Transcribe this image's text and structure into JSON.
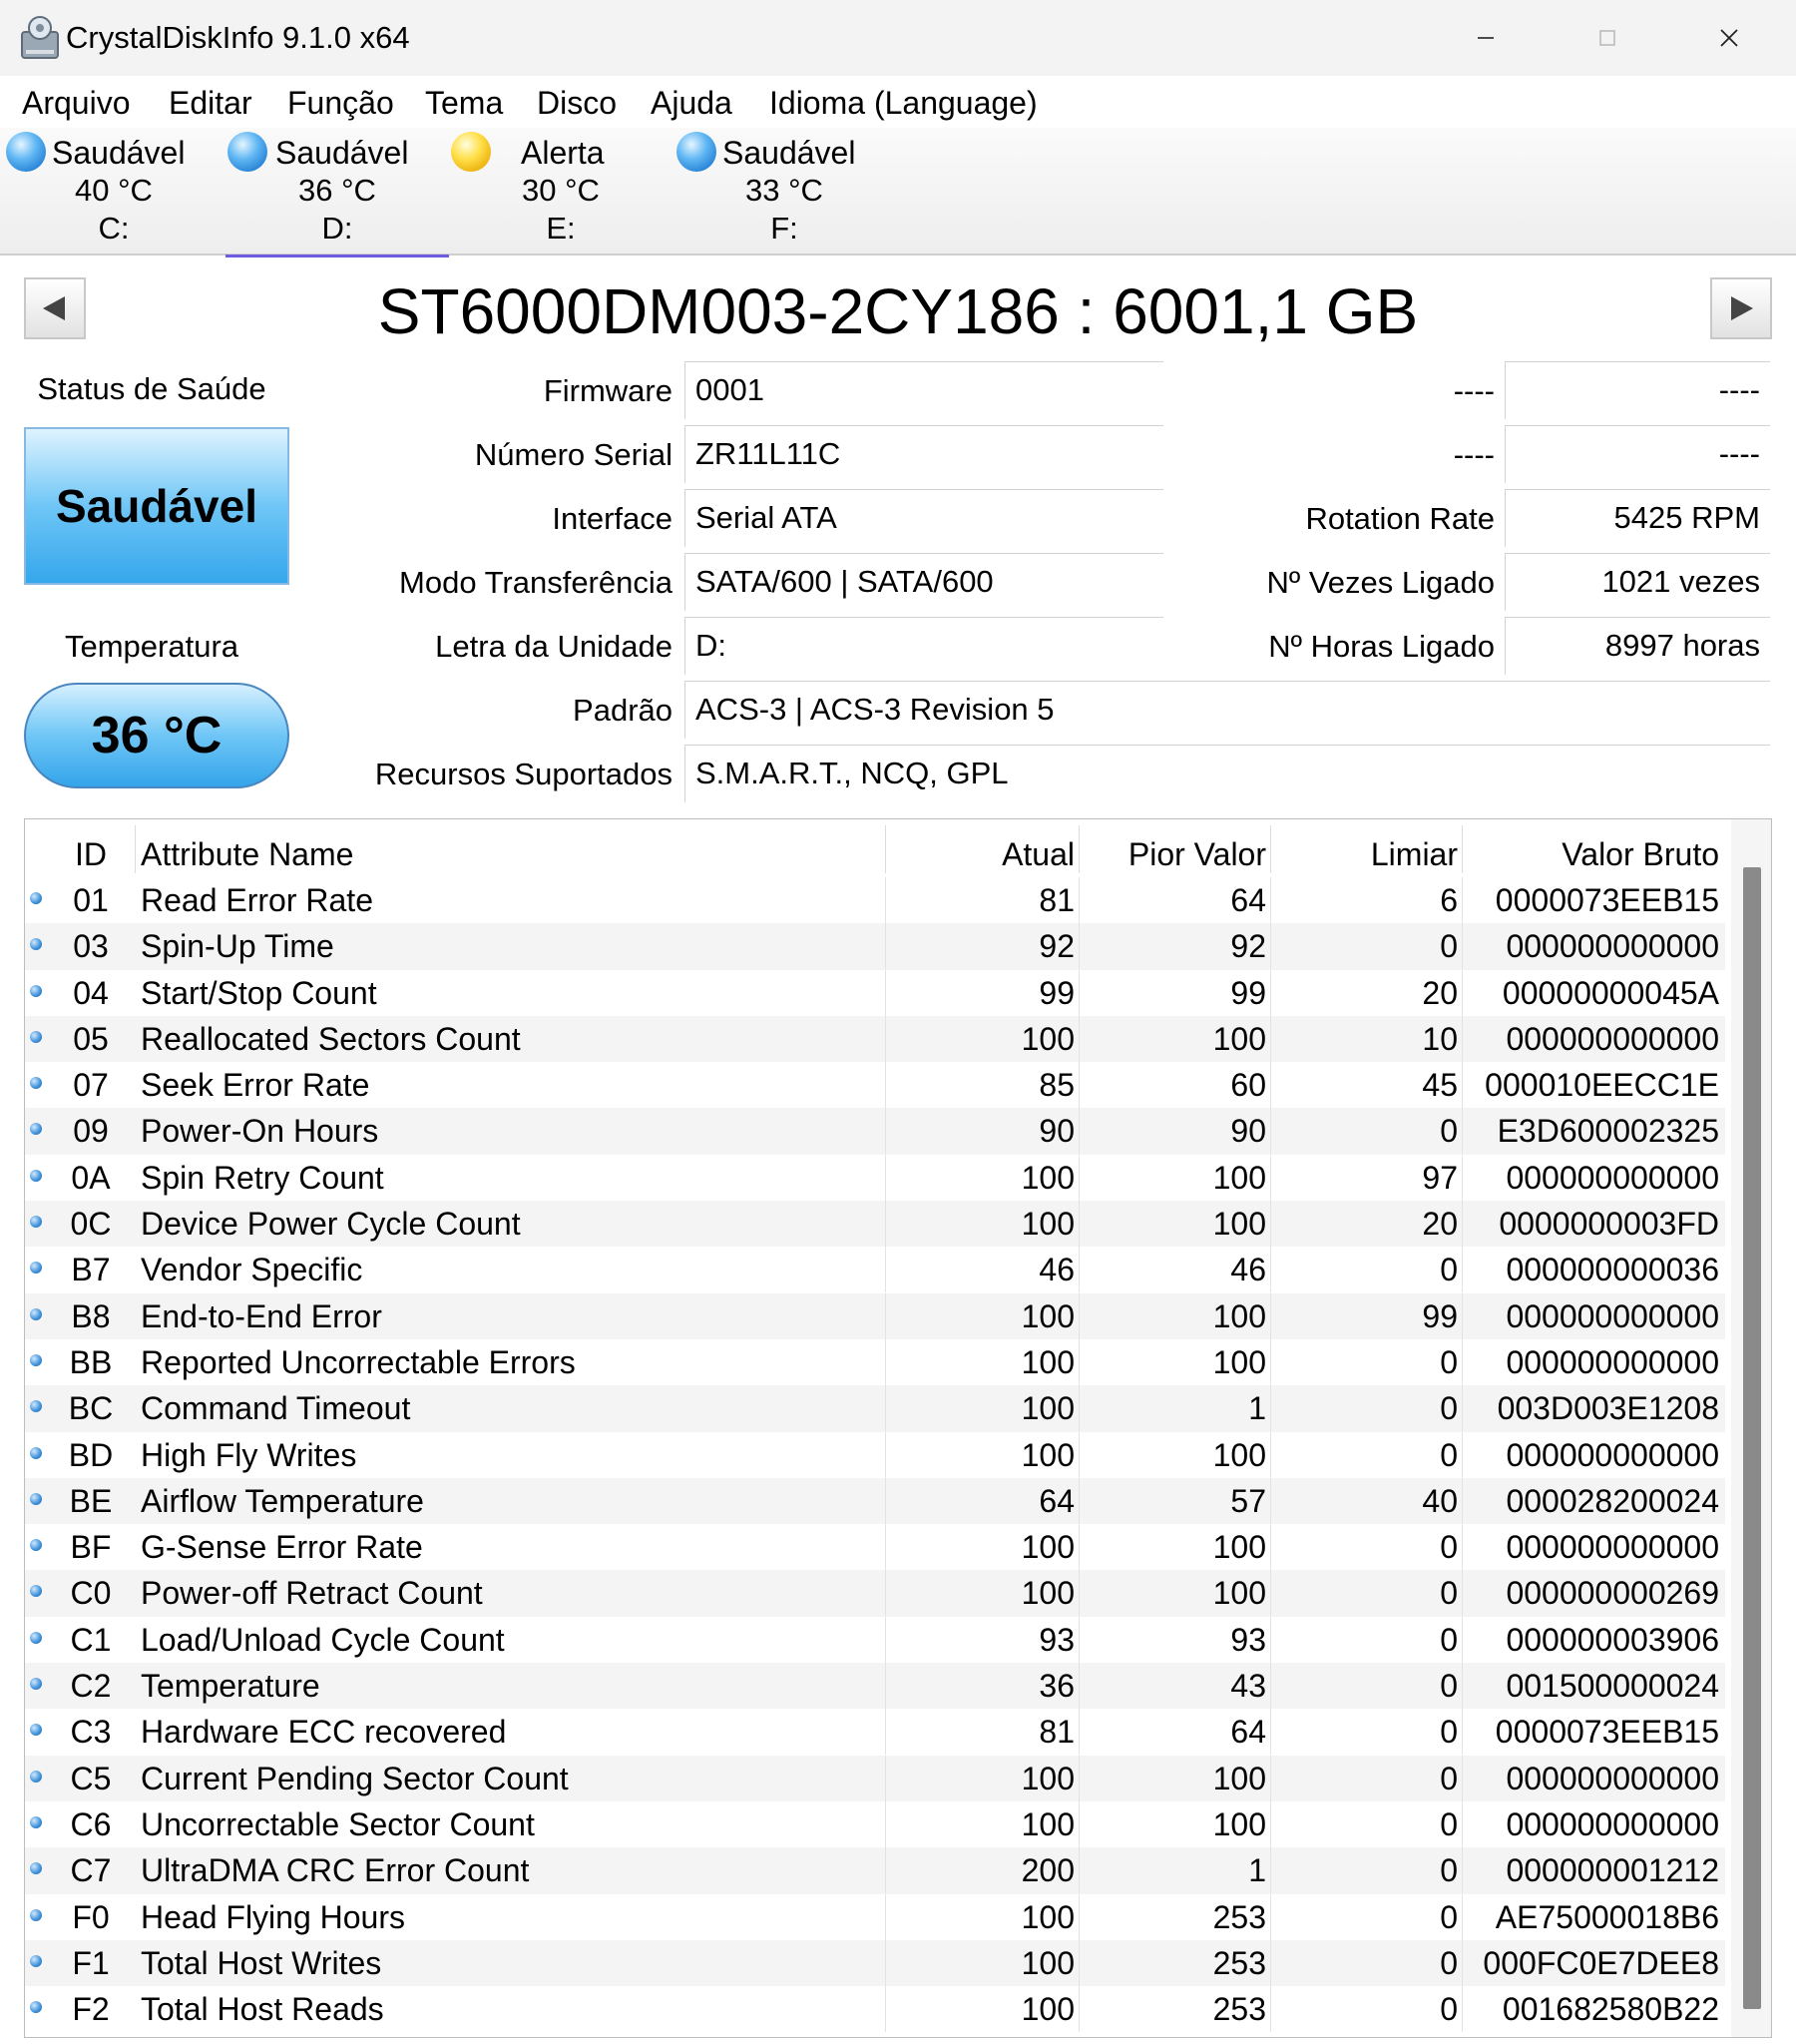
{
  "window": {
    "title": "CrystalDiskInfo 9.1.0 x64"
  },
  "menu": [
    "Arquivo",
    "Editar",
    "Função",
    "Tema",
    "Disco",
    "Ajuda",
    "Idioma (Language)"
  ],
  "drives": [
    {
      "status": "Saudável",
      "temp": "40 °C",
      "letter": "C:",
      "state": "good"
    },
    {
      "status": "Saudável",
      "temp": "36 °C",
      "letter": "D:",
      "state": "good"
    },
    {
      "status": "Alerta",
      "temp": "30 °C",
      "letter": "E:",
      "state": "caution"
    },
    {
      "status": "Saudável",
      "temp": "33 °C",
      "letter": "F:",
      "state": "good"
    }
  ],
  "disk": {
    "model_title": "ST6000DM003-2CY186 : 6001,1 GB",
    "health_label": "Status de Saúde",
    "health_value": "Saudável",
    "temp_label": "Temperatura",
    "temp_value": "36 °C"
  },
  "fields": {
    "firmware_label": "Firmware",
    "firmware": "0001",
    "serial_label": "Número Serial",
    "serial": "ZR11L11C",
    "interface_label": "Interface",
    "interface": "Serial ATA",
    "transfer_label": "Modo Transferência",
    "transfer": "SATA/600 | SATA/600",
    "drive_letter_label": "Letra da Unidade",
    "drive_letter": "D:",
    "standard_label": "Padrão",
    "standard": "ACS-3 | ACS-3 Revision 5",
    "features_label": "Recursos Suportados",
    "features": "S.M.A.R.T., NCQ, GPL",
    "blank1_label": "----",
    "blank1": "----",
    "blank2_label": "----",
    "blank2": "----",
    "rotation_label": "Rotation Rate",
    "rotation": "5425 RPM",
    "power_count_label": "Nº Vezes Ligado",
    "power_count": "1021 vezes",
    "power_hours_label": "Nº Horas Ligado",
    "power_hours": "8997 horas"
  },
  "smart": {
    "columns": {
      "id": "ID",
      "name": "Attribute Name",
      "current": "Atual",
      "worst": "Pior Valor",
      "threshold": "Limiar",
      "raw": "Valor Bruto"
    },
    "rows": [
      [
        "01",
        "Read Error Rate",
        "81",
        "64",
        "6",
        "0000073EEB15"
      ],
      [
        "03",
        "Spin-Up Time",
        "92",
        "92",
        "0",
        "000000000000"
      ],
      [
        "04",
        "Start/Stop Count",
        "99",
        "99",
        "20",
        "00000000045A"
      ],
      [
        "05",
        "Reallocated Sectors Count",
        "100",
        "100",
        "10",
        "000000000000"
      ],
      [
        "07",
        "Seek Error Rate",
        "85",
        "60",
        "45",
        "000010EECC1E"
      ],
      [
        "09",
        "Power-On Hours",
        "90",
        "90",
        "0",
        "E3D600002325"
      ],
      [
        "0A",
        "Spin Retry Count",
        "100",
        "100",
        "97",
        "000000000000"
      ],
      [
        "0C",
        "Device Power Cycle Count",
        "100",
        "100",
        "20",
        "0000000003FD"
      ],
      [
        "B7",
        "Vendor Specific",
        "46",
        "46",
        "0",
        "000000000036"
      ],
      [
        "B8",
        "End-to-End Error",
        "100",
        "100",
        "99",
        "000000000000"
      ],
      [
        "BB",
        "Reported Uncorrectable Errors",
        "100",
        "100",
        "0",
        "000000000000"
      ],
      [
        "BC",
        "Command Timeout",
        "100",
        "1",
        "0",
        "003D003E1208"
      ],
      [
        "BD",
        "High Fly Writes",
        "100",
        "100",
        "0",
        "000000000000"
      ],
      [
        "BE",
        "Airflow Temperature",
        "64",
        "57",
        "40",
        "000028200024"
      ],
      [
        "BF",
        "G-Sense Error Rate",
        "100",
        "100",
        "0",
        "000000000000"
      ],
      [
        "C0",
        "Power-off Retract Count",
        "100",
        "100",
        "0",
        "000000000269"
      ],
      [
        "C1",
        "Load/Unload Cycle Count",
        "93",
        "93",
        "0",
        "000000003906"
      ],
      [
        "C2",
        "Temperature",
        "36",
        "43",
        "0",
        "001500000024"
      ],
      [
        "C3",
        "Hardware ECC recovered",
        "81",
        "64",
        "0",
        "0000073EEB15"
      ],
      [
        "C5",
        "Current Pending Sector Count",
        "100",
        "100",
        "0",
        "000000000000"
      ],
      [
        "C6",
        "Uncorrectable Sector Count",
        "100",
        "100",
        "0",
        "000000000000"
      ],
      [
        "C7",
        "UltraDMA CRC Error Count",
        "200",
        "1",
        "0",
        "000000001212"
      ],
      [
        "F0",
        "Head Flying Hours",
        "100",
        "253",
        "0",
        "AE75000018B6"
      ],
      [
        "F1",
        "Total Host Writes",
        "100",
        "253",
        "0",
        "000FC0E7DEE8"
      ],
      [
        "F2",
        "Total Host Reads",
        "100",
        "253",
        "0",
        "001682580B22"
      ]
    ]
  }
}
